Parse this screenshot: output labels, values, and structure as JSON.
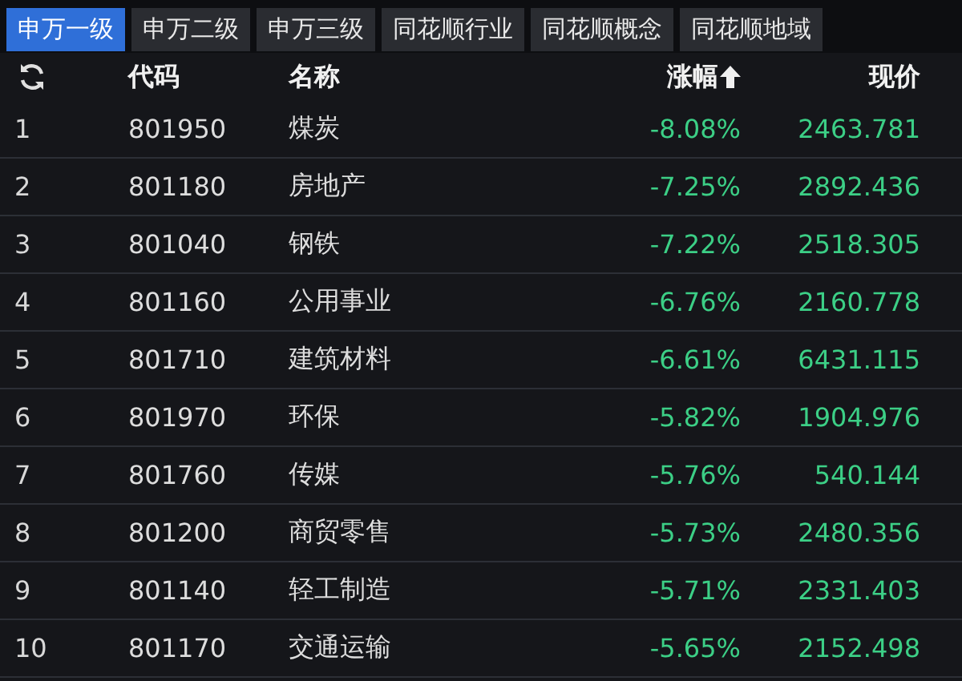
{
  "tabs": [
    {
      "label": "申万一级",
      "selected": true
    },
    {
      "label": "申万二级",
      "selected": false
    },
    {
      "label": "申万三级",
      "selected": false
    },
    {
      "label": "同花顺行业",
      "selected": false
    },
    {
      "label": "同花顺概念",
      "selected": false
    },
    {
      "label": "同花顺地域",
      "selected": false
    }
  ],
  "table": {
    "columns": [
      {
        "label": "代码",
        "sorted": false
      },
      {
        "label": "名称",
        "sorted": false
      },
      {
        "label": "涨幅",
        "sorted": true
      },
      {
        "label": "现价",
        "sorted": false
      }
    ],
    "rows": [
      {
        "index": "1",
        "code": "801950",
        "name": "煤炭",
        "change": "-8.08%",
        "price": "2463.781"
      },
      {
        "index": "2",
        "code": "801180",
        "name": "房地产",
        "change": "-7.25%",
        "price": "2892.436"
      },
      {
        "index": "3",
        "code": "801040",
        "name": "钢铁",
        "change": "-7.22%",
        "price": "2518.305"
      },
      {
        "index": "4",
        "code": "801160",
        "name": "公用事业",
        "change": "-6.76%",
        "price": "2160.778"
      },
      {
        "index": "5",
        "code": "801710",
        "name": "建筑材料",
        "change": "-6.61%",
        "price": "6431.115"
      },
      {
        "index": "6",
        "code": "801970",
        "name": "环保",
        "change": "-5.82%",
        "price": "1904.976"
      },
      {
        "index": "7",
        "code": "801760",
        "name": "传媒",
        "change": "-5.76%",
        "price": "540.144"
      },
      {
        "index": "8",
        "code": "801200",
        "name": "商贸零售",
        "change": "-5.73%",
        "price": "2480.356"
      },
      {
        "index": "9",
        "code": "801140",
        "name": "轻工制造",
        "change": "-5.71%",
        "price": "2331.403"
      },
      {
        "index": "10",
        "code": "801170",
        "name": "交通运输",
        "change": "-5.65%",
        "price": "2152.498"
      }
    ]
  }
}
